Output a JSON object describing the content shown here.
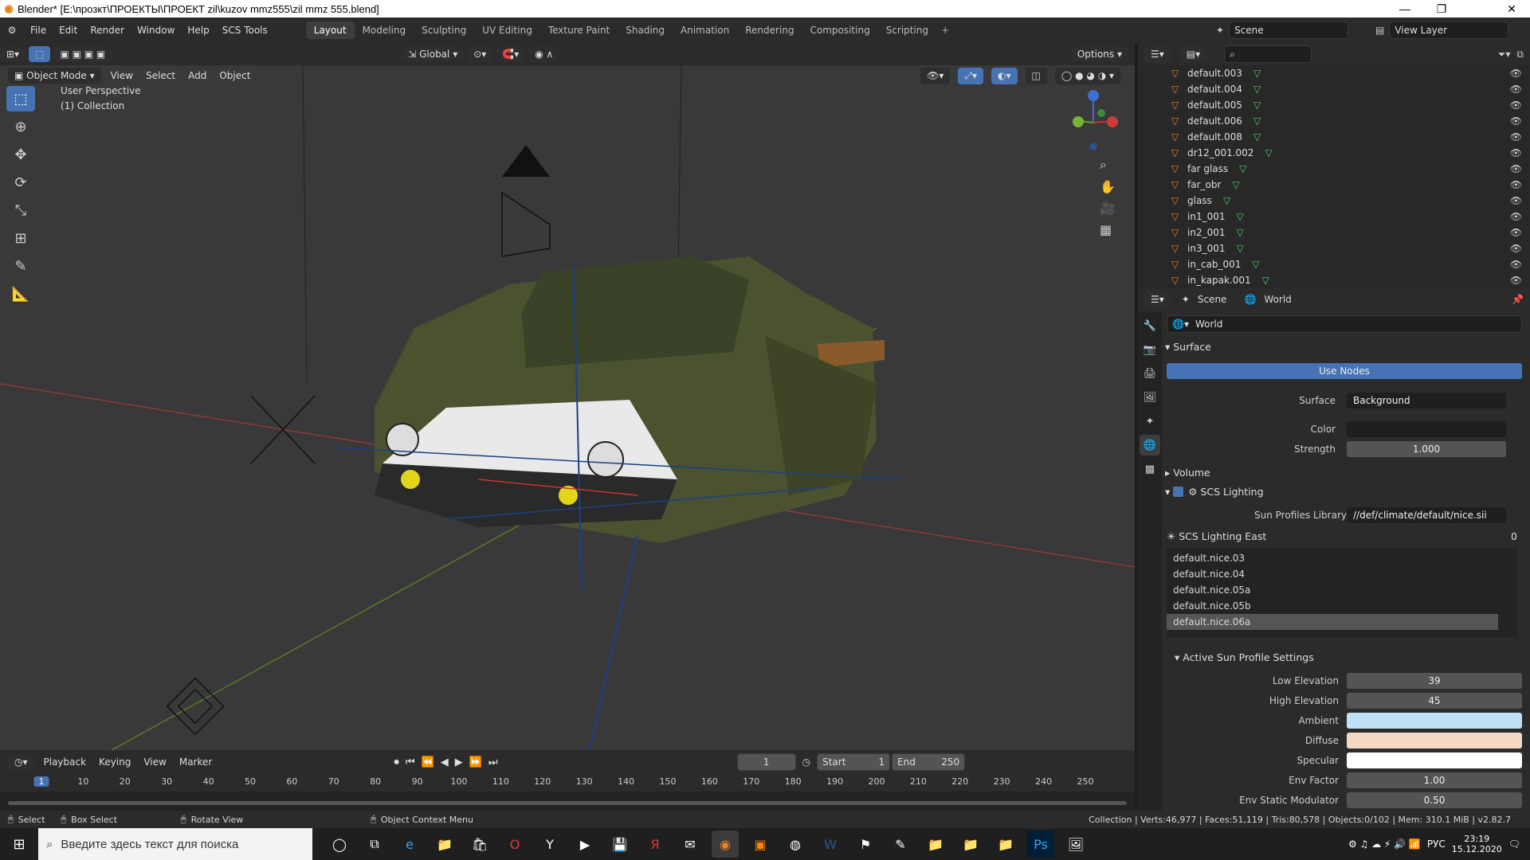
{
  "window": {
    "title": "Blender* [E:\\прозкт\\ПРОЕКТЫ\\ПРОЕКТ zil\\kuzov mmz555\\zil mmz 555.blend]"
  },
  "topmenu": [
    "File",
    "Edit",
    "Render",
    "Window",
    "Help",
    "SCS Tools"
  ],
  "workspaces": [
    "Layout",
    "Modeling",
    "Sculpting",
    "UV Editing",
    "Texture Paint",
    "Shading",
    "Animation",
    "Rendering",
    "Compositing",
    "Scripting"
  ],
  "scene": {
    "label": "Scene",
    "view_layer": "View Layer"
  },
  "viewport": {
    "transform": "Global",
    "options": "Options",
    "mode": "Object Mode",
    "menus": [
      "View",
      "Select",
      "Add",
      "Object"
    ],
    "overlay_title": "User Perspective",
    "overlay_collection": "(1) Collection"
  },
  "outliner": {
    "items": [
      "default.003",
      "default.004",
      "default.005",
      "default.006",
      "default.008",
      "dr12_001.002",
      "far glass",
      "far_obr",
      "glass",
      "in1_001",
      "in2_001",
      "in3_001",
      "in_cab_001",
      "in_kapak.001"
    ]
  },
  "properties": {
    "breadcrumb_scene": "Scene",
    "breadcrumb_world": "World",
    "world_name": "World",
    "surface_header": "Surface",
    "use_nodes": "Use Nodes",
    "surface_label": "Surface",
    "surface_value": "Background",
    "color_label": "Color",
    "strength_label": "Strength",
    "strength_value": "1.000",
    "volume_header": "Volume",
    "scs_header": "SCS Lighting",
    "sun_lib_label": "Sun Profiles Library",
    "sun_lib_value": "//def/climate/default/nice.sii",
    "scs_east": "SCS Lighting East",
    "scs_east_count": "0",
    "profiles": [
      "default.nice.03",
      "default.nice.04",
      "default.nice.05a",
      "default.nice.05b",
      "default.nice.06a"
    ],
    "active_header": "Active Sun Profile Settings",
    "low_elev_label": "Low Elevation",
    "low_elev": "39",
    "high_elev_label": "High Elevation",
    "high_elev": "45",
    "ambient_label": "Ambient",
    "ambient_color": "#bfe0f5",
    "diffuse_label": "Diffuse",
    "diffuse_color": "#f3d9c4",
    "specular_label": "Specular",
    "specular_color": "#ffffff",
    "env_label": "Env Factor",
    "env_value": "1.00",
    "envstat_label": "Env Static Modulator",
    "envstat_value": "0.50"
  },
  "timeline": {
    "menus": [
      "Playback",
      "Keying",
      "View",
      "Marker"
    ],
    "current": "1",
    "start_label": "Start",
    "start": "1",
    "end_label": "End",
    "end": "250",
    "ticks": [
      "1",
      "10",
      "20",
      "30",
      "40",
      "50",
      "60",
      "70",
      "80",
      "90",
      "100",
      "110",
      "120",
      "130",
      "140",
      "150",
      "160",
      "170",
      "180",
      "190",
      "200",
      "210",
      "220",
      "230",
      "240",
      "250"
    ]
  },
  "status": {
    "select": "Select",
    "box": "Box Select",
    "rotate": "Rotate View",
    "context": "Object Context Menu",
    "stats": "Collection | Verts:46,977 | Faces:51,119 | Tris:80,578 | Objects:0/102 | Mem: 310.1 MiB | v2.82.7"
  },
  "taskbar": {
    "search_placeholder": "Введите здесь текст для поиска",
    "lang": "РУС",
    "time": "23:19",
    "date": "15.12.2020"
  },
  "colors": {
    "accent": "#4772b3",
    "orange": "#e8851a",
    "bg": "#393939"
  }
}
